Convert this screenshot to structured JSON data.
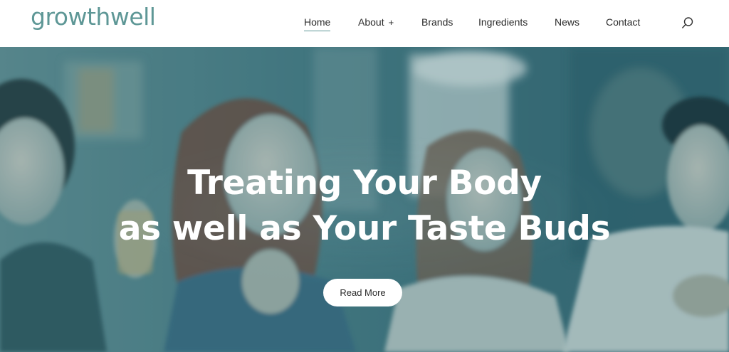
{
  "brand": {
    "logo_text": "growthwell",
    "accent_color": "#5e9796"
  },
  "nav": {
    "items": [
      {
        "label": "Home",
        "active": true
      },
      {
        "label": "About",
        "suffix": "+"
      },
      {
        "label": "Brands"
      },
      {
        "label": "Ingredients"
      },
      {
        "label": "News"
      },
      {
        "label": "Contact"
      }
    ],
    "search_icon": "search-icon"
  },
  "hero": {
    "title_line1": "Treating Your Body",
    "title_line2": "as well as Your Taste Buds",
    "button_label": "Read More",
    "overlay_color": "#1e5a64"
  }
}
